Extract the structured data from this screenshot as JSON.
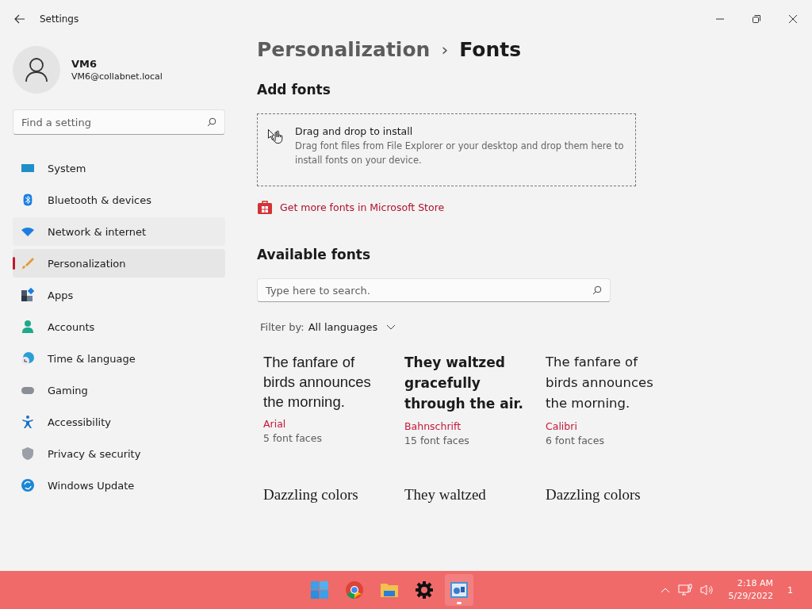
{
  "window": {
    "title": "Settings"
  },
  "user": {
    "name": "VM6",
    "email": "VM6@collabnet.local"
  },
  "search": {
    "placeholder": "Find a setting"
  },
  "nav": [
    {
      "label": "System",
      "selected": false,
      "hovered": false
    },
    {
      "label": "Bluetooth & devices",
      "selected": false,
      "hovered": false
    },
    {
      "label": "Network & internet",
      "selected": false,
      "hovered": true
    },
    {
      "label": "Personalization",
      "selected": true,
      "hovered": false
    },
    {
      "label": "Apps",
      "selected": false,
      "hovered": false
    },
    {
      "label": "Accounts",
      "selected": false,
      "hovered": false
    },
    {
      "label": "Time & language",
      "selected": false,
      "hovered": false
    },
    {
      "label": "Gaming",
      "selected": false,
      "hovered": false
    },
    {
      "label": "Accessibility",
      "selected": false,
      "hovered": false
    },
    {
      "label": "Privacy & security",
      "selected": false,
      "hovered": false
    },
    {
      "label": "Windows Update",
      "selected": false,
      "hovered": false
    }
  ],
  "breadcrumb": {
    "parent": "Personalization",
    "separator": "›",
    "current": "Fonts"
  },
  "add_fonts": {
    "heading": "Add fonts",
    "drop_title": "Drag and drop to install",
    "drop_text": "Drag font files from File Explorer or your desktop and drop them here to install fonts on your device.",
    "store_link": "Get more fonts in Microsoft Store"
  },
  "available": {
    "heading": "Available fonts",
    "search_placeholder": "Type here to search.",
    "filter_label": "Filter by:",
    "filter_value": "All languages"
  },
  "fonts": [
    {
      "kind": "sans",
      "preview": "The fanfare of birds announces the morning.",
      "name": "Arial",
      "faces": "5 font faces"
    },
    {
      "kind": "condensed",
      "preview": "They waltzed gracefully through the air.",
      "name": "Bahnschrift",
      "faces": "15 font faces"
    },
    {
      "kind": "humanist",
      "preview": "The fanfare of birds announces the morning.",
      "name": "Calibri",
      "faces": "6 font faces"
    },
    {
      "kind": "serif",
      "preview": "Dazzling colors"
    },
    {
      "kind": "serif",
      "preview": "They waltzed"
    },
    {
      "kind": "serif",
      "preview": "Dazzling colors"
    }
  ],
  "taskbar": {
    "apps": [
      {
        "active": false
      },
      {
        "active": false
      },
      {
        "active": false
      },
      {
        "active": false
      },
      {
        "active": true
      }
    ],
    "time": "2:18 AM",
    "date": "5/29/2022",
    "notifications": "1"
  }
}
